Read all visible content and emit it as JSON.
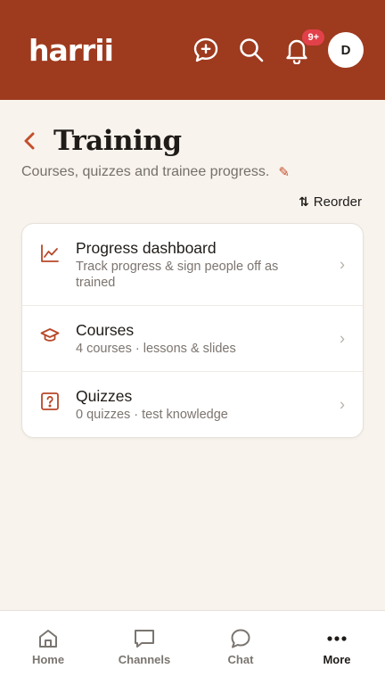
{
  "app": {
    "logo": "harrii",
    "notification_badge": "9+",
    "avatar_initial": "D"
  },
  "page": {
    "title": "Training",
    "subtitle": "Courses, quizzes and trainee progress.",
    "edit_icon": "✎",
    "reorder_label": "Reorder"
  },
  "items": [
    {
      "title": "Progress dashboard",
      "description": "Track progress & sign people off as trained",
      "icon": "chart-icon"
    },
    {
      "title": "Courses",
      "description": "4 courses · lessons & slides",
      "icon": "graduation-cap-icon"
    },
    {
      "title": "Quizzes",
      "description": "0 quizzes · test knowledge",
      "icon": "question-icon"
    }
  ],
  "nav": [
    {
      "label": "Home",
      "icon": "home-icon",
      "active": false
    },
    {
      "label": "Channels",
      "icon": "channels-icon",
      "active": false
    },
    {
      "label": "Chat",
      "icon": "chat-icon",
      "active": false
    },
    {
      "label": "More",
      "icon": "more-icon",
      "active": true
    }
  ],
  "colors": {
    "header": "#9e3a1e",
    "accent": "#c2502c",
    "badge": "#e2414a",
    "background": "#f8f3ed"
  }
}
